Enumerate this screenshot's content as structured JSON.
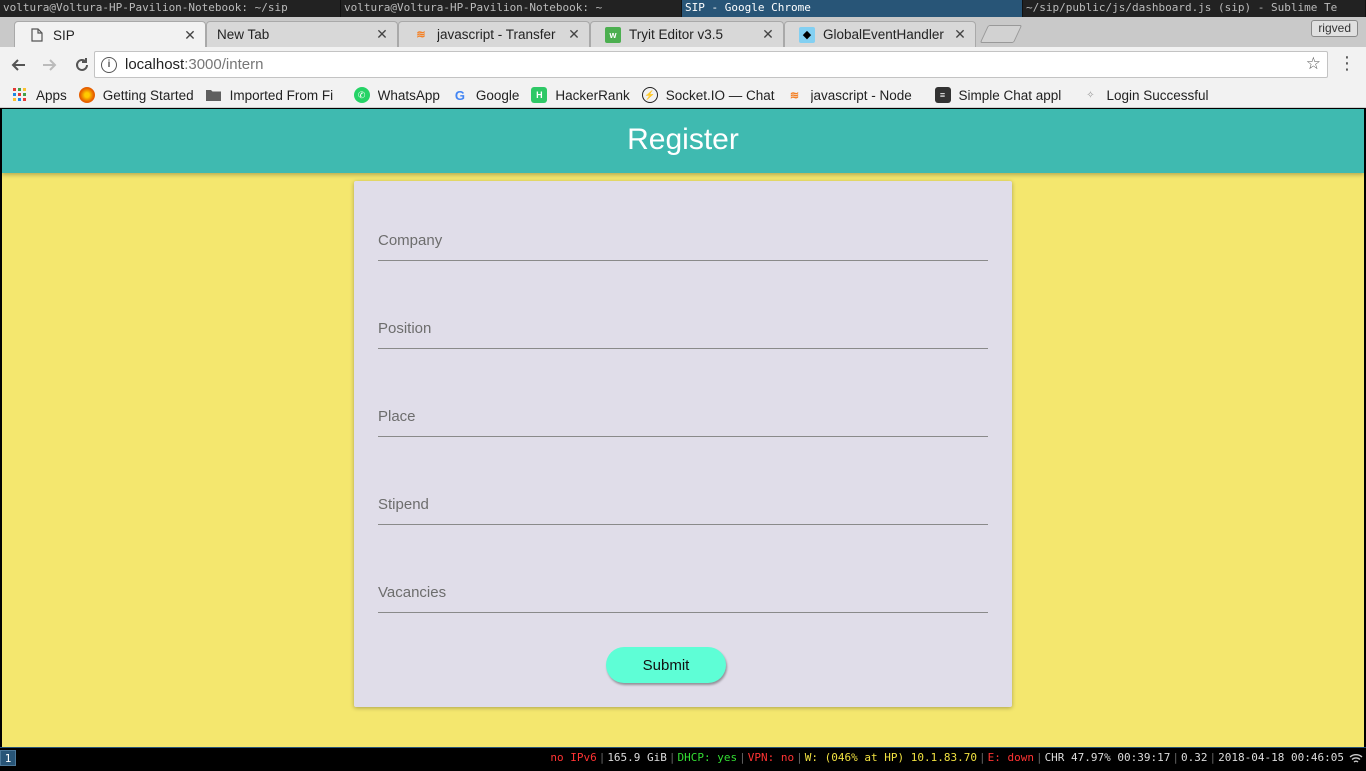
{
  "wm_windows": [
    {
      "title": "voltura@Voltura-HP-Pavilion-Notebook: ~/sip",
      "active": false
    },
    {
      "title": "voltura@Voltura-HP-Pavilion-Notebook: ~",
      "active": false
    },
    {
      "title": "SIP - Google Chrome",
      "active": true
    },
    {
      "title": "~/sip/public/js/dashboard.js (sip) - Sublime Te",
      "active": false
    }
  ],
  "tabs": [
    {
      "title": "SIP",
      "icon": "document-icon",
      "active": true
    },
    {
      "title": "New Tab",
      "icon": "",
      "active": false
    },
    {
      "title": "javascript - Transfer",
      "icon": "stackoverflow-icon",
      "active": false
    },
    {
      "title": "Tryit Editor v3.5",
      "icon": "w3schools-icon",
      "active": false
    },
    {
      "title": "GlobalEventHandler",
      "icon": "mdn-icon",
      "active": false
    }
  ],
  "profile": "rigved",
  "address": {
    "host": "localhost",
    "path": ":3000/intern"
  },
  "bookmarks": [
    {
      "label": "Apps",
      "icon": "apps-grid-icon"
    },
    {
      "label": "Getting Started",
      "icon": "firefox-icon"
    },
    {
      "label": "Imported From Fi",
      "icon": "folder-icon"
    },
    {
      "label": "WhatsApp",
      "icon": "whatsapp-icon"
    },
    {
      "label": "Google",
      "icon": "google-icon"
    },
    {
      "label": "HackerRank",
      "icon": "hackerrank-icon"
    },
    {
      "label": "Socket.IO — Chat",
      "icon": "socketio-icon"
    },
    {
      "label": "javascript - Node",
      "icon": "stackoverflow-icon"
    },
    {
      "label": "Simple Chat appl",
      "icon": "chat-app-icon"
    },
    {
      "label": "Login Successful",
      "icon": "puzzle-icon"
    }
  ],
  "page": {
    "header_title": "Register",
    "fields": [
      {
        "placeholder": "Company"
      },
      {
        "placeholder": "Position"
      },
      {
        "placeholder": "Place"
      },
      {
        "placeholder": "Stipend"
      },
      {
        "placeholder": "Vacancies"
      }
    ],
    "submit_label": "Submit"
  },
  "colors": {
    "page_bg": "#f4e76e",
    "header_bg": "#3fbab0",
    "card_bg": "#e0dde9",
    "button_bg": "#5efed6"
  },
  "statusbar": {
    "workspace": "1",
    "items": [
      {
        "text": "no IPv6",
        "color": "#ff3333"
      },
      {
        "text": "165.9 GiB",
        "color": "#dddddd"
      },
      {
        "text": "DHCP: yes",
        "color": "#33dd33"
      },
      {
        "text": "VPN: no",
        "color": "#ff3333"
      },
      {
        "text": "W: (046% at HP) 10.1.83.70",
        "color": "#f0e040"
      },
      {
        "text": "E: down",
        "color": "#ff3333"
      },
      {
        "text": "CHR 47.97% 00:39:17",
        "color": "#dddddd"
      },
      {
        "text": "0.32",
        "color": "#dddddd"
      },
      {
        "text": "2018-04-18 00:46:05",
        "color": "#dddddd"
      }
    ]
  }
}
